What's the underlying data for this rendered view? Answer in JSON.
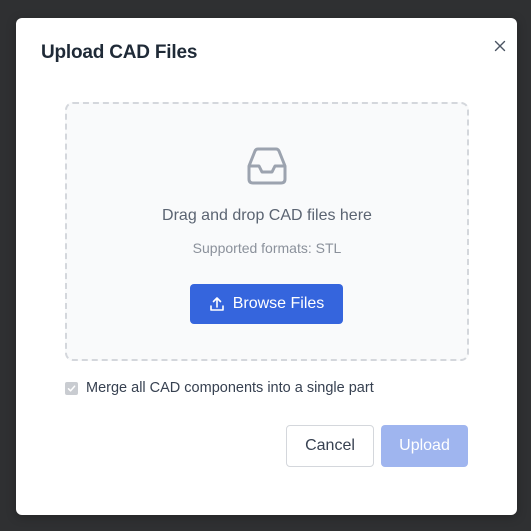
{
  "modal": {
    "title": "Upload CAD Files",
    "close_icon": "close-icon"
  },
  "dropzone": {
    "icon": "inbox-icon",
    "text": "Drag and drop CAD files here",
    "formats": "Supported formats: STL",
    "browse_icon": "upload-icon",
    "browse_label": "Browse Files"
  },
  "options": {
    "merge_label": "Merge all CAD components into a single part",
    "merge_checked": true,
    "merge_disabled": true
  },
  "actions": {
    "cancel_label": "Cancel",
    "upload_label": "Upload",
    "upload_disabled": true
  },
  "colors": {
    "primary": "#3565dd",
    "primary_disabled": "#9fb5ef",
    "backdrop": "#2f3032"
  }
}
